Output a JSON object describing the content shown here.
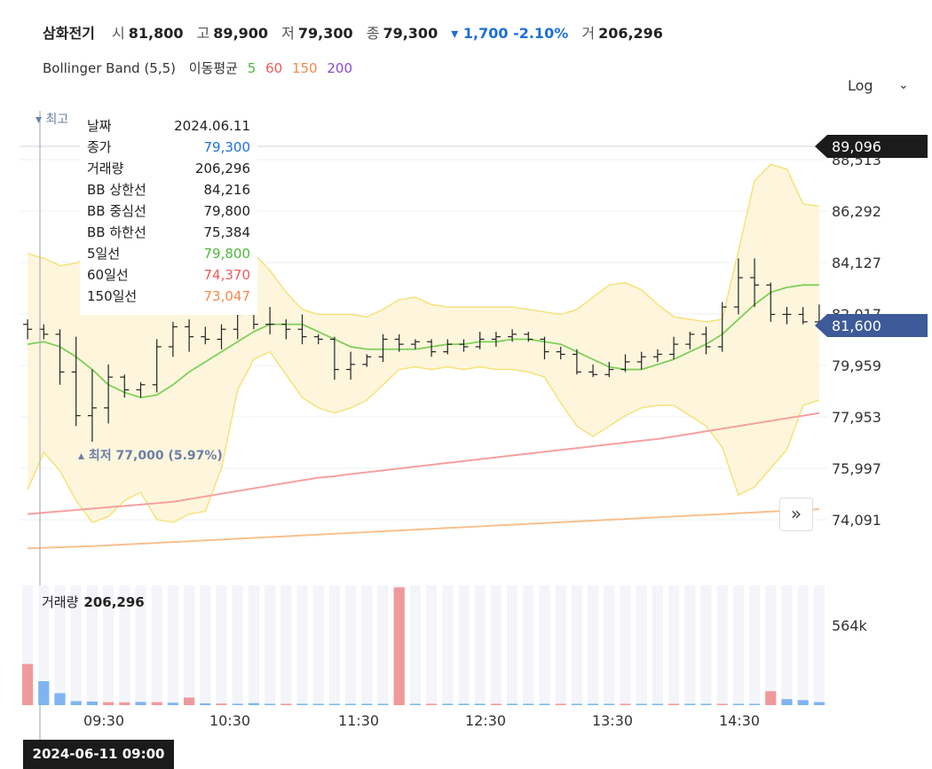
{
  "header": {
    "name": "삼화전기",
    "open_label": "시",
    "open": "81,800",
    "high_label": "고",
    "high": "89,900",
    "low_label": "저",
    "low": "79,300",
    "close_label": "종",
    "close": "79,300",
    "change": "▾ 1,700 -2.10%",
    "vol_label": "거",
    "volume": "206,296"
  },
  "indicators": {
    "bb": "Bollinger Band (5,5)",
    "ma_label": "이동평균",
    "ma5": "5",
    "ma60": "60",
    "ma150": "150",
    "ma200": "200"
  },
  "log_label": "Log",
  "colors": {
    "ma5": "#4db83a",
    "ma60": "#f05a5a",
    "ma150": "#f08a4b",
    "ma200": "#8a4bd0",
    "band": "#f5e27a",
    "down": "#1e6fd9"
  },
  "tooltip": [
    {
      "k": "날짜",
      "v": "2024.06.11",
      "c": "#222"
    },
    {
      "k": "종가",
      "v": "79,300",
      "c": "#1e6fd9"
    },
    {
      "k": "거래량",
      "v": "206,296",
      "c": "#222"
    },
    {
      "k": "BB 상한선",
      "v": "84,216",
      "c": "#222"
    },
    {
      "k": "BB 중심선",
      "v": "79,800",
      "c": "#222"
    },
    {
      "k": "BB 하한선",
      "v": "75,384",
      "c": "#222"
    },
    {
      "k": "5일선",
      "v": "79,800",
      "c": "#4db83a"
    },
    {
      "k": "60일선",
      "v": "74,370",
      "c": "#f05a5a"
    },
    {
      "k": "150일선",
      "v": "73,047",
      "c": "#f08a4b"
    }
  ],
  "volume_label": "거래량",
  "volume_value": "206,296",
  "crosshair_date": "2024-06-11 09:00",
  "max_annotation": "▾ 최고",
  "min_annotation": "▴ 최저 77,000 (5.97%)",
  "chart_data": {
    "type": "candlestick",
    "y_scale": "log",
    "y_ticks": [
      "88,513",
      "86,292",
      "84,127",
      "82,017",
      "79,959",
      "77,953",
      "75,997",
      "74,091"
    ],
    "x_ticks": [
      "09:30",
      "10:30",
      "11:30",
      "12:30",
      "13:30",
      "14:30"
    ],
    "high_marker": "89,096",
    "last_marker": "81,600",
    "volume_tick": "564k",
    "candles": [
      [
        81600,
        81800,
        81000,
        81400
      ],
      [
        81400,
        81600,
        81000,
        81200
      ],
      [
        81200,
        81400,
        79200,
        79700
      ],
      [
        79700,
        81100,
        77600,
        78000
      ],
      [
        78000,
        79800,
        77000,
        78300
      ],
      [
        78300,
        80000,
        77700,
        79500
      ],
      [
        79500,
        79600,
        78700,
        79000
      ],
      [
        79000,
        79300,
        78700,
        79200
      ],
      [
        79200,
        81000,
        78900,
        80700
      ],
      [
        80700,
        81700,
        80300,
        81500
      ],
      [
        81500,
        81800,
        80500,
        81100
      ],
      [
        81100,
        81500,
        80800,
        81000
      ],
      [
        81000,
        81600,
        80600,
        81400
      ],
      [
        81400,
        82200,
        81000,
        82000
      ],
      [
        82000,
        82400,
        81400,
        81600
      ],
      [
        81600,
        82300,
        81200,
        81600
      ],
      [
        81600,
        81800,
        81000,
        81400
      ],
      [
        81400,
        82000,
        80800,
        81100
      ],
      [
        81100,
        81200,
        80800,
        81000
      ],
      [
        81000,
        81100,
        79400,
        79800
      ],
      [
        79800,
        80500,
        79400,
        80000
      ],
      [
        80000,
        80400,
        79900,
        80300
      ],
      [
        80300,
        81200,
        80100,
        81000
      ],
      [
        81000,
        81200,
        80500,
        80800
      ],
      [
        80800,
        81000,
        80600,
        80900
      ],
      [
        80900,
        81000,
        80300,
        80500
      ],
      [
        80500,
        81000,
        80400,
        80800
      ],
      [
        80800,
        81000,
        80500,
        80700
      ],
      [
        80700,
        81300,
        80600,
        81000
      ],
      [
        81000,
        81300,
        80700,
        81100
      ],
      [
        81100,
        81400,
        80900,
        81200
      ],
      [
        81200,
        81300,
        80900,
        81000
      ],
      [
        81000,
        81100,
        80200,
        80500
      ],
      [
        80500,
        80700,
        80200,
        80400
      ],
      [
        80400,
        80600,
        79600,
        79700
      ],
      [
        79700,
        80000,
        79500,
        79600
      ],
      [
        79600,
        80100,
        79500,
        79800
      ],
      [
        79800,
        80400,
        79700,
        80100
      ],
      [
        80100,
        80500,
        79800,
        80300
      ],
      [
        80300,
        80600,
        80100,
        80400
      ],
      [
        80400,
        81100,
        80200,
        80800
      ],
      [
        80800,
        81300,
        80600,
        81200
      ],
      [
        81200,
        81500,
        80400,
        80700
      ],
      [
        80700,
        82500,
        80500,
        82300
      ],
      [
        82300,
        84300,
        82000,
        83500
      ],
      [
        83500,
        84300,
        82300,
        83200
      ],
      [
        83200,
        83300,
        81700,
        82000
      ],
      [
        82000,
        82300,
        81600,
        82000
      ],
      [
        82000,
        82300,
        81600,
        81700
      ],
      [
        81700,
        82400,
        81600,
        81600
      ]
    ],
    "ma5": [
      80800,
      80900,
      80700,
      80300,
      79800,
      79200,
      78900,
      78700,
      78800,
      79200,
      79700,
      80100,
      80500,
      80900,
      81300,
      81600,
      81600,
      81600,
      81300,
      81000,
      80700,
      80600,
      80600,
      80600,
      80600,
      80700,
      80800,
      80800,
      80900,
      80900,
      81000,
      81000,
      80900,
      80800,
      80500,
      80200,
      79900,
      79800,
      79800,
      80000,
      80200,
      80500,
      80800,
      81200,
      81800,
      82400,
      82900,
      83100,
      83200,
      83200
    ],
    "bb_upper": [
      84500,
      84300,
      84000,
      84100,
      84400,
      84200,
      83800,
      83600,
      84500,
      86500,
      86400,
      86000,
      85200,
      84800,
      84500,
      83800,
      82900,
      82200,
      82000,
      82000,
      82000,
      81900,
      82200,
      82600,
      82700,
      82400,
      82300,
      82300,
      82300,
      82300,
      82300,
      82200,
      82100,
      82000,
      82200,
      82700,
      83200,
      83300,
      83000,
      82400,
      81900,
      81800,
      81700,
      81800,
      84600,
      87600,
      88300,
      88100,
      86600,
      86500
    ],
    "bb_lower": [
      75200,
      76600,
      75900,
      74800,
      74000,
      74200,
      74800,
      75100,
      74100,
      74000,
      74300,
      74400,
      76000,
      79000,
      80200,
      80500,
      79600,
      78700,
      78300,
      78100,
      78300,
      78600,
      79200,
      79800,
      79900,
      79800,
      79900,
      79800,
      79900,
      79800,
      79800,
      79700,
      79500,
      78500,
      77600,
      77200,
      77600,
      78000,
      78300,
      78400,
      78400,
      78000,
      77600,
      76800,
      75000,
      75300,
      76000,
      76700,
      78400,
      78600
    ],
    "ma60": [
      74300,
      74350,
      74400,
      74450,
      74500,
      74550,
      74600,
      74650,
      74700,
      74750,
      74850,
      74950,
      75050,
      75150,
      75250,
      75350,
      75450,
      75550,
      75650,
      75700,
      75780,
      75850,
      75920,
      75990,
      76060,
      76130,
      76200,
      76270,
      76340,
      76410,
      76480,
      76550,
      76620,
      76690,
      76760,
      76830,
      76900,
      76970,
      77040,
      77110,
      77200,
      77300,
      77400,
      77500,
      77600,
      77700,
      77800,
      77900,
      78000,
      78100
    ],
    "ma150": [
      73050,
      73070,
      73090,
      73110,
      73130,
      73160,
      73190,
      73220,
      73250,
      73280,
      73310,
      73340,
      73370,
      73400,
      73430,
      73460,
      73490,
      73520,
      73550,
      73580,
      73610,
      73640,
      73670,
      73700,
      73730,
      73760,
      73790,
      73820,
      73850,
      73880,
      73910,
      73940,
      73970,
      74000,
      74030,
      74060,
      74090,
      74120,
      74150,
      74180,
      74210,
      74240,
      74270,
      74300,
      74330,
      74360,
      74390,
      74420,
      74450,
      74480
    ],
    "volume": [
      206296,
      120000,
      60000,
      20000,
      18000,
      15000,
      14000,
      16000,
      15000,
      12000,
      38000,
      9000,
      8000,
      7000,
      10000,
      6000,
      6000,
      5000,
      4000,
      3000,
      2000,
      2000,
      2000,
      590000,
      2000,
      2000,
      2000,
      2000,
      2000,
      2000,
      2000,
      2000,
      2000,
      3000,
      2000,
      2000,
      2000,
      2000,
      2000,
      3000,
      2000,
      2000,
      2000,
      3000,
      2000,
      1000,
      70000,
      30000,
      25000,
      15000
    ],
    "volume_up": [
      true,
      false,
      false,
      false,
      false,
      true,
      true,
      false,
      true,
      false,
      true,
      false,
      true,
      false,
      false,
      false,
      true,
      false,
      false,
      false,
      false,
      false,
      false,
      true,
      false,
      true,
      false,
      false,
      false,
      true,
      false,
      false,
      false,
      true,
      false,
      false,
      false,
      true,
      false,
      false,
      true,
      false,
      false,
      true,
      false,
      false,
      true,
      false,
      false,
      false
    ]
  }
}
